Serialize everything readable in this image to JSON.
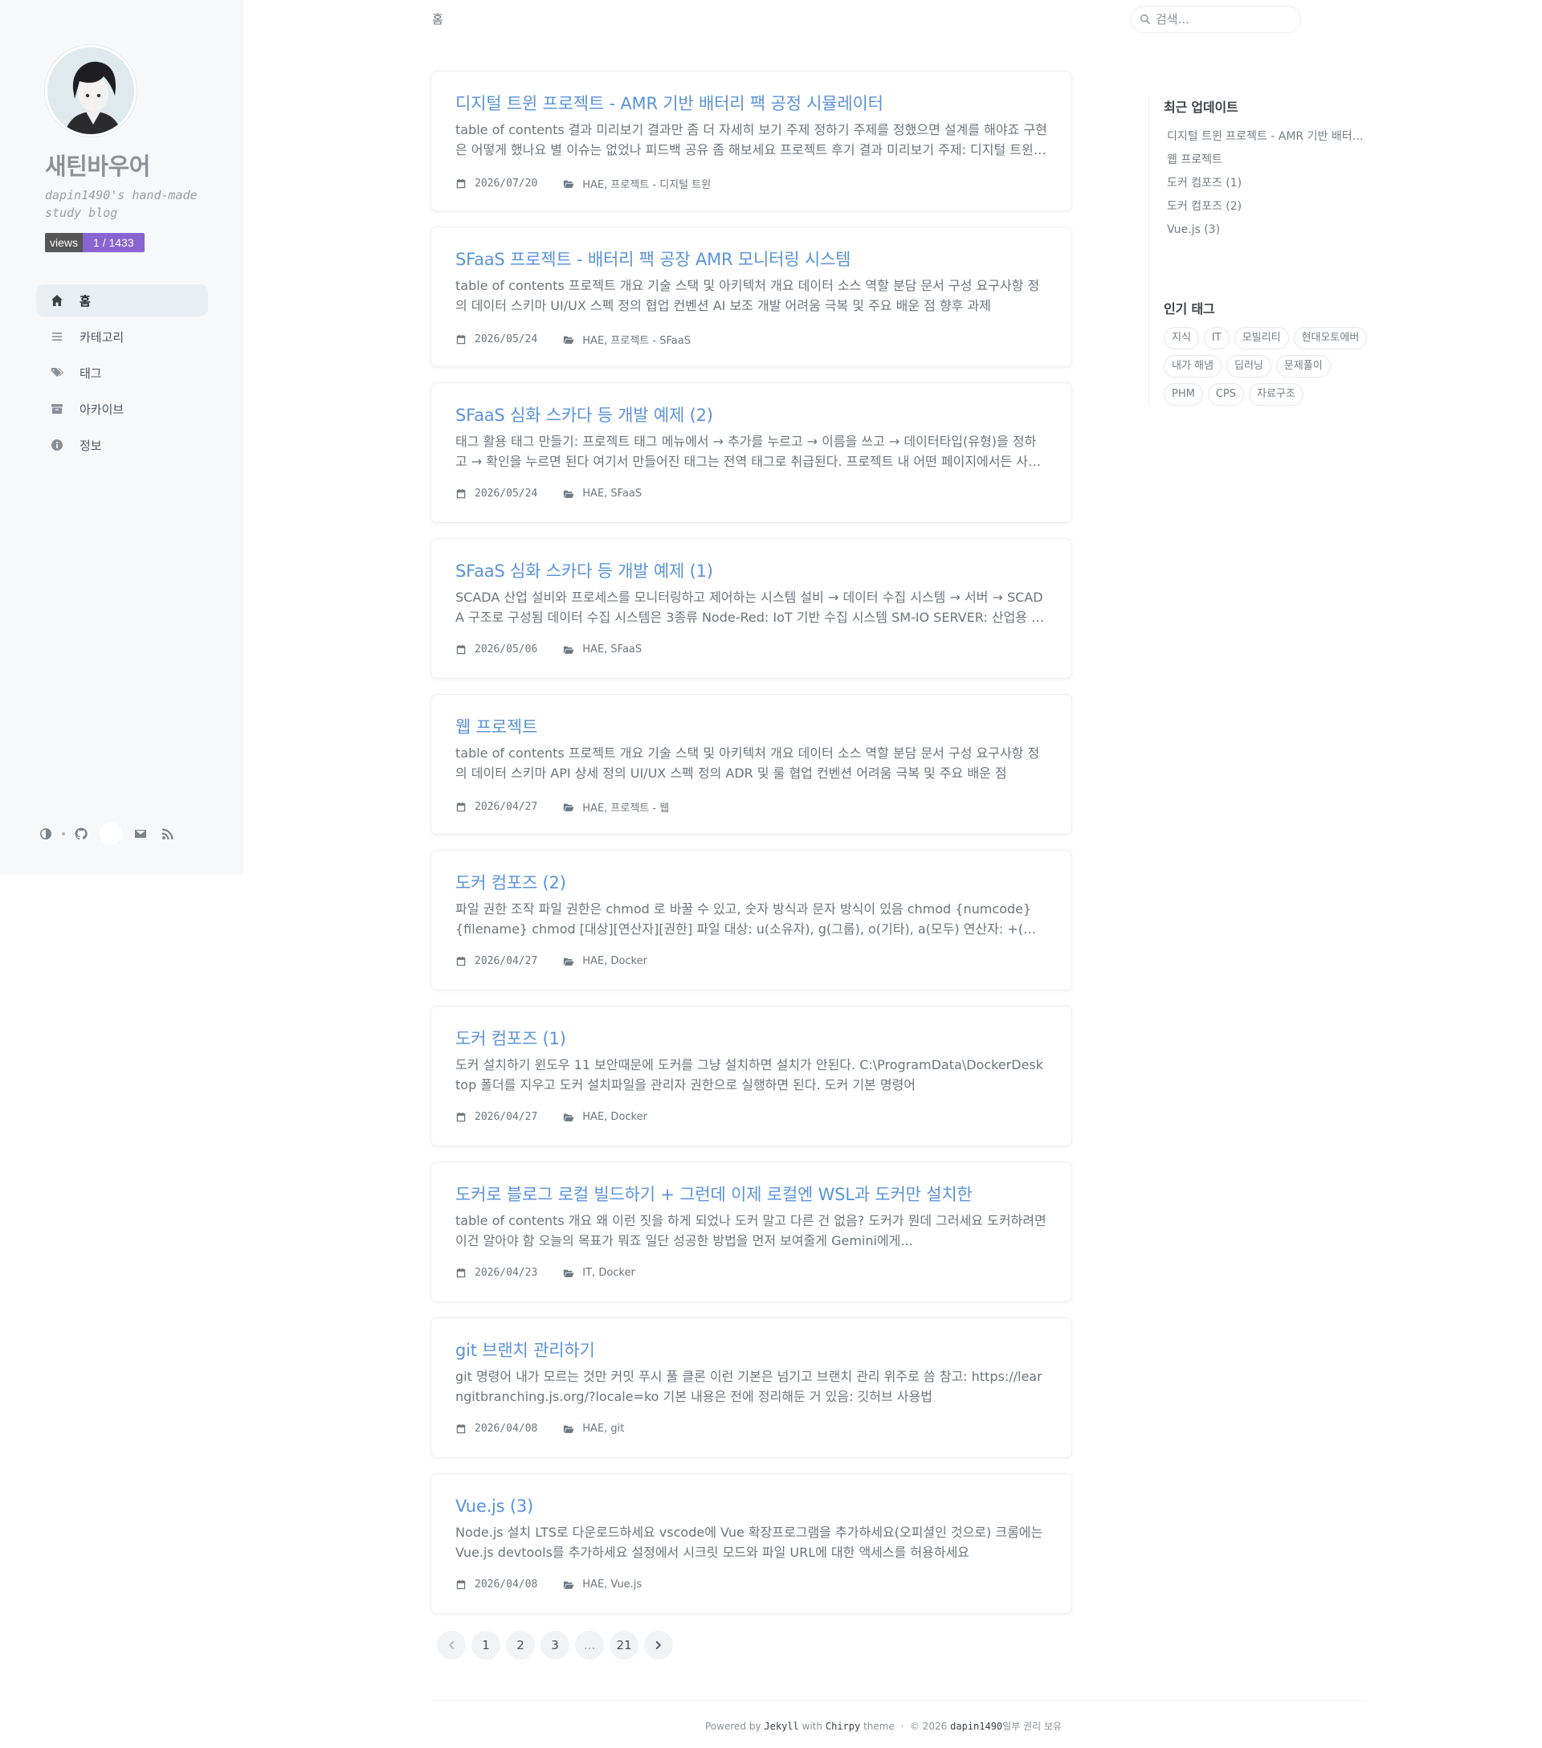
{
  "sidebar": {
    "site_title": "새틴바우어",
    "site_subtitle": "dapin1490's hand-made study blog",
    "views_label": "views",
    "views_value": "1 / 1433",
    "nav": [
      {
        "label": "홈",
        "icon": "home-icon",
        "active": true
      },
      {
        "label": "카테고리",
        "icon": "stream-icon",
        "active": false
      },
      {
        "label": "태그",
        "icon": "tags-icon",
        "active": false
      },
      {
        "label": "아카이브",
        "icon": "archive-icon",
        "active": false
      },
      {
        "label": "정보",
        "icon": "info-icon",
        "active": false
      }
    ],
    "bottom_icons": [
      "theme-toggle-icon",
      "github-icon",
      "blank-icon",
      "email-icon",
      "rss-icon"
    ]
  },
  "topbar": {
    "breadcrumb": "홈",
    "search_placeholder": "검색..."
  },
  "posts": [
    {
      "title": "디지털 트윈 프로젝트 - AMR 기반 배터리 팩 공정 시뮬레이터",
      "excerpt": "table of contents 결과 미리보기 결과만 좀 더 자세히 보기 주제 정하기 주제를 정했으면 설계를 해야죠 구현은 어떻게 했나요 별 이슈는 없었나 피드백 공유 좀 해보세요 프로젝트 후기 결과 미리보기 주제: 디지털 트윈 기반 AMR 배터리 팩 공정 시뮬레이터",
      "date": "2026/07/20",
      "categories": "HAE, 프로젝트 - 디지털 트윈"
    },
    {
      "title": "SFaaS 프로젝트 - 배터리 팩 공장 AMR 모니터링 시스템",
      "excerpt": "table of contents 프로젝트 개요 기술 스택 및 아키텍처 개요 데이터 소스 역할 분담 문서 구성 요구사항 정의 데이터 스키마 UI/UX 스펙 정의 협업 컨벤션 AI 보조 개발 어려움 극복 및 주요 배운 점 향후 과제",
      "date": "2026/05/24",
      "categories": "HAE, 프로젝트 - SFaaS"
    },
    {
      "title": "SFaaS 심화 스카다 등 개발 예제 (2)",
      "excerpt": "태그 활용 태그 만들기: 프로젝트 태그 메뉴에서 → 추가를 누르고 → 이름을 쓰고 → 데이터타입(유형)을 정하고 → 확인을 누르면 된다 여기서 만들어진 태그는 전역 태그로 취급된다. 프로젝트 내 어떤 페이지에서든 사용 가능",
      "date": "2026/05/24",
      "categories": "HAE, SFaaS"
    },
    {
      "title": "SFaaS 심화 스카다 등 개발 예제 (1)",
      "excerpt": "SCADA 산업 설비와 프로세스를 모니터링하고 제어하는 시스템 설비 → 데이터 수집 시스템 → 서버 → SCADA 구조로 구성됨 데이터 수집 시스템은 3종류 Node-Red: IoT 기반 수집 시스템 SM-IO SERVER: 산업용 프로토콜",
      "date": "2026/05/06",
      "categories": "HAE, SFaaS"
    },
    {
      "title": "웹 프로젝트",
      "excerpt": "table of contents 프로젝트 개요 기술 스택 및 아키텍처 개요 데이터 소스 역할 분담 문서 구성 요구사항 정의 데이터 스키마 API 상세 정의 UI/UX 스펙 정의 ADR 및 룰 협업 컨벤션 어려움 극복 및 주요 배운 점",
      "date": "2026/04/27",
      "categories": "HAE, 프로젝트 - 웹"
    },
    {
      "title": "도커 컴포즈 (2)",
      "excerpt": "파일 권한 조작 파일 권한은 chmod 로 바꿀 수 있고, 숫자 방식과 문자 방식이 있음 chmod {numcode} {filename} chmod [대상][연산자][권한] 파일 대상: u(소유자), g(그룹), o(기타), a(모두) 연산자: +(추가)",
      "date": "2026/04/27",
      "categories": "HAE, Docker"
    },
    {
      "title": "도커 컴포즈 (1)",
      "excerpt": "도커 설치하기 윈도우 11 보안때문에 도커를 그냥 설치하면 설치가 안된다. C:\\ProgramData\\DockerDesktop 폴더를 지우고 도커 설치파일을 관리자 권한으로 실행하면 된다. 도커 기본 명령어",
      "date": "2026/04/27",
      "categories": "HAE, Docker"
    },
    {
      "title": "도커로 블로그 로컬 빌드하기 + 그런데 이제 로컬엔 WSL과 도커만 설치한",
      "excerpt": "table of contents 개요 왜 이런 짓을 하게 되었나 도커 말고 다른 건 없음? 도커가 뭔데 그러세요 도커하려면 이건 알아야 함 오늘의 목표가 뭐죠 일단 성공한 방법을 먼저 보여줄게 Gemini에게...",
      "date": "2026/04/23",
      "categories": "IT, Docker"
    },
    {
      "title": "git 브랜치 관리하기",
      "excerpt": "git 명령어 내가 모르는 것만 커밋 푸시 풀 클론 이런 기본은 넘기고 브랜치 관리 위주로 씀 참고: https://learngitbranching.js.org/?locale=ko 기본 내용은 전에 정리해둔 거 있음: 깃허브 사용법",
      "date": "2026/04/08",
      "categories": "HAE, git"
    },
    {
      "title": "Vue.js (3)",
      "excerpt": "Node.js 설치 LTS로 다운로드하세요 vscode에 Vue 확장프로그램을 추가하세요(오피셜인 것으로) 크롬에는 Vue.js devtools를 추가하세요 설정에서 시크릿 모드와 파일 URL에 대한 액세스를 허용하세요",
      "date": "2026/04/08",
      "categories": "HAE, Vue.js"
    }
  ],
  "pagination": {
    "pages": [
      "1",
      "2",
      "3",
      "...",
      "21"
    ]
  },
  "footer": {
    "powered_by": "Powered by",
    "jekyll": "Jekyll",
    "with": "with",
    "chirpy": "Chirpy",
    "theme": "theme",
    "separator": "·",
    "copyright": "© 2026",
    "author": "dapin1490",
    "rights": "일부 권리 보유"
  },
  "panel": {
    "recent_heading": "최근 업데이트",
    "recent": [
      "디지털 트윈 프로젝트 - AMR 기반 배터리 팩 공정 시뮬레이터",
      "웹 프로젝트",
      "도커 컴포즈 (1)",
      "도커 컴포즈 (2)",
      "Vue.js (3)"
    ],
    "tags_heading": "인기 태그",
    "tags": [
      "지식",
      "IT",
      "모빌리티",
      "현대오토에버",
      "내가 해냄",
      "딥러닝",
      "문제풀이",
      "PHM",
      "CPS",
      "자료구조"
    ]
  }
}
